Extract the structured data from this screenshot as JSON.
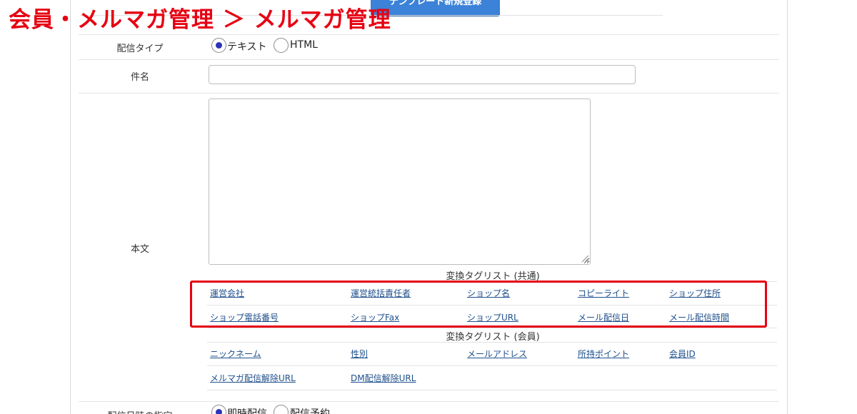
{
  "overlay_title": "会員・メルマガ管理 ＞ メルマガ管理",
  "template_button_label": "テンプレート新規登録",
  "delivery_type": {
    "label": "配信タイプ",
    "options": [
      "テキスト",
      "HTML"
    ],
    "selected": "テキスト"
  },
  "subject": {
    "label": "件名",
    "value": ""
  },
  "body": {
    "label": "本文",
    "value": ""
  },
  "tag_lists": [
    {
      "header": "変換タグリスト (共通)",
      "tags": [
        "運営会社",
        "運営統括責任者",
        "ショップ名",
        "コピーライト",
        "ショップ住所",
        "ショップ電話番号",
        "ショップFax",
        "ショップURL",
        "メール配信日",
        "メール配信時間"
      ]
    },
    {
      "header": "変換タグリスト (会員)",
      "tags": [
        "ニックネーム",
        "性別",
        "メールアドレス",
        "所持ポイント",
        "会員ID",
        "メルマガ配信解除URL",
        "DM配信解除URL"
      ]
    }
  ],
  "schedule": {
    "label": "配信日時の指定",
    "options": [
      "即時配信",
      "配信予約"
    ],
    "selected": "即時配信"
  },
  "colors": {
    "accent_red": "#e60012",
    "link": "#1f4f8c",
    "button_blue": "#3b82d8",
    "radio_dot": "#2b33b8"
  }
}
